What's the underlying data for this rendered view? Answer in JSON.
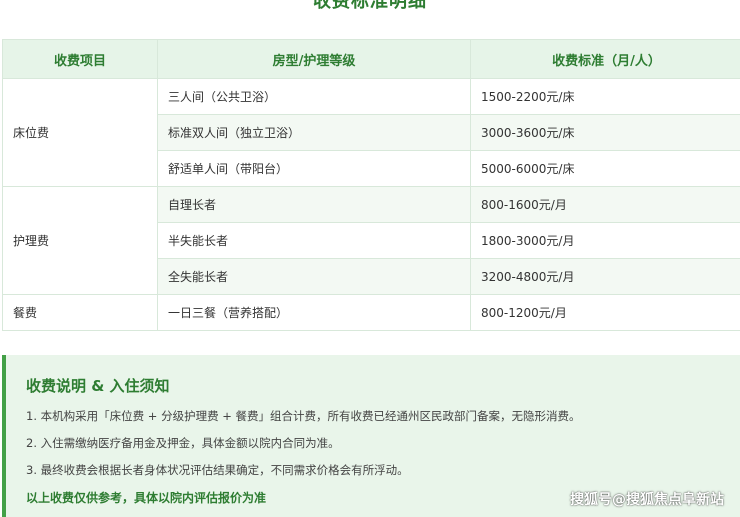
{
  "page_title": "收费标准明细",
  "table": {
    "headers": [
      "收费项目",
      "房型/护理等级",
      "收费标准（月/人）"
    ],
    "groups": [
      {
        "category": "床位费",
        "rows": [
          {
            "item": "三人间（公共卫浴）",
            "price": "1500-2200元/床"
          },
          {
            "item": "标准双人间（独立卫浴）",
            "price": "3000-3600元/床"
          },
          {
            "item": "舒适单人间（带阳台）",
            "price": "5000-6000元/床"
          }
        ]
      },
      {
        "category": "护理费",
        "rows": [
          {
            "item": "自理长者",
            "price": "800-1600元/月"
          },
          {
            "item": "半失能长者",
            "price": "1800-3000元/月"
          },
          {
            "item": "全失能长者",
            "price": "3200-4800元/月"
          }
        ]
      },
      {
        "category": "餐费",
        "rows": [
          {
            "item": "一日三餐（营养搭配）",
            "price": "800-1200元/月"
          }
        ]
      }
    ]
  },
  "notice": {
    "title": "收费说明 & 入住须知",
    "items": [
      "1. 本机构采用「床位费 + 分级护理费 + 餐费」组合计费，所有收费已经通州区民政部门备案，无隐形消费。",
      "2. 入住需缴纳医疗备用金及押金，具体金额以院内合同为准。",
      "3. 最终收费会根据长者身体状况评估结果确定，不同需求价格会有所浮动。"
    ],
    "footer": "以上收费仅供参考，具体以院内评估报价为准"
  },
  "watermark": "搜狐号@搜狐焦点阜新站",
  "colors": {
    "accent": "#2e7d32",
    "header_bg": "#e6f4e8",
    "notice_bg": "#e9f5ea",
    "notice_border": "#43a047"
  }
}
